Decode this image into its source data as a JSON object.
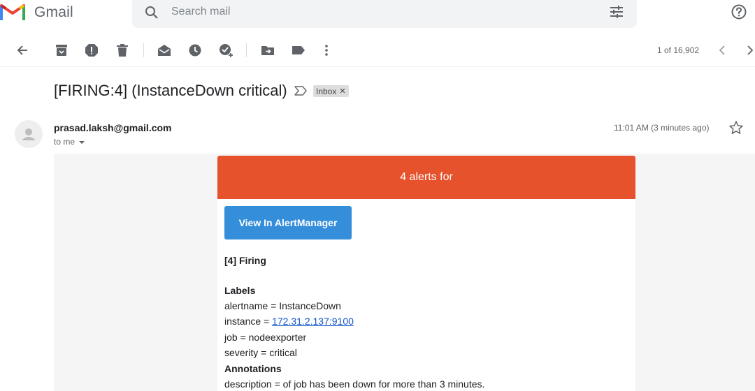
{
  "app": {
    "name": "Gmail"
  },
  "search": {
    "placeholder": "Search mail"
  },
  "toolbar": {
    "page_count": "1 of 16,902"
  },
  "message": {
    "subject": "[FIRING:4] (InstanceDown critical)",
    "label": "Inbox",
    "sender": "prasad.laksh@gmail.com",
    "recipient": "to me",
    "timestamp": "11:01 AM (3 minutes ago)"
  },
  "alert": {
    "header": "4 alerts for",
    "button_label": "View In AlertManager",
    "firing_heading": "[4] Firing",
    "labels_heading": "Labels",
    "labels": {
      "alertname_key": "alertname = ",
      "alertname_value": "InstanceDown",
      "instance_key": "instance = ",
      "instance_value": "172.31.2.137:9100",
      "job_key": "job = ",
      "job_value": "nodeexporter",
      "severity_key": "severity = ",
      "severity_value": "critical"
    },
    "annotations_heading": "Annotations",
    "annotations": {
      "description_key": "description = ",
      "description_value": "of job has been down for more than 3 minutes."
    }
  },
  "colors": {
    "gmail_red": "#ea4335",
    "alert_header_bg": "#e6522c",
    "button_bg": "#348eda",
    "link": "#1155cc"
  },
  "icons": {
    "header": [
      "gmail-logo-icon",
      "search-icon",
      "search-options-icon",
      "help-icon"
    ],
    "toolbar": [
      "back-icon",
      "archive-icon",
      "report-spam-icon",
      "delete-icon",
      "mark-unread-icon",
      "snooze-icon",
      "add-to-tasks-icon",
      "move-to-icon",
      "labels-icon",
      "more-icon",
      "newer-icon",
      "older-icon"
    ],
    "message": [
      "important-marker-icon",
      "label-remove-icon",
      "avatar-icon",
      "recipient-details-icon",
      "star-icon"
    ]
  }
}
